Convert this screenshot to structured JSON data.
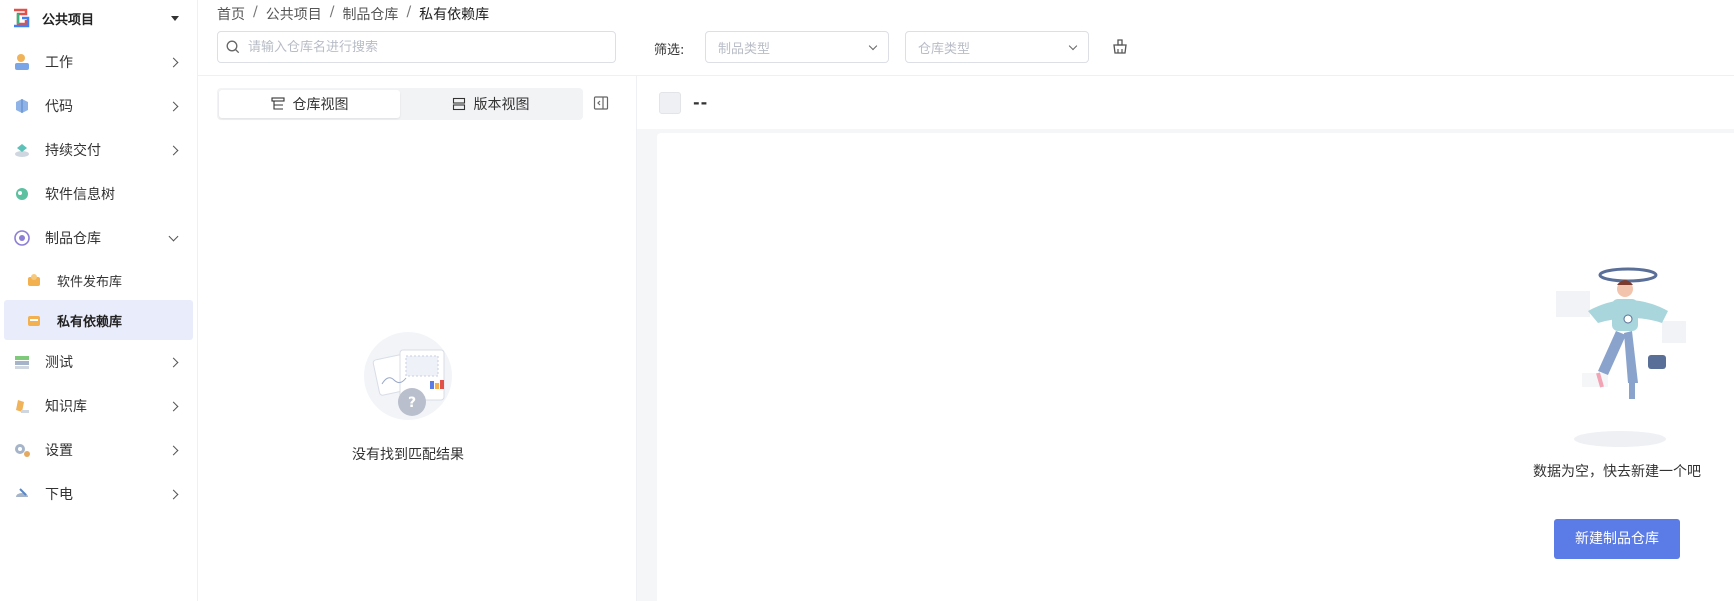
{
  "project": {
    "name": "公共项目"
  },
  "sidebar": {
    "items": [
      {
        "label": "工作"
      },
      {
        "label": "代码"
      },
      {
        "label": "持续交付"
      },
      {
        "label": "软件信息树"
      },
      {
        "label": "制品仓库"
      },
      {
        "label": "测试"
      },
      {
        "label": "知识库"
      },
      {
        "label": "设置"
      },
      {
        "label": "下电"
      }
    ],
    "sub_items": [
      {
        "label": "软件发布库"
      },
      {
        "label": "私有依赖库"
      }
    ]
  },
  "breadcrumb": {
    "items": [
      "首页",
      "公共项目",
      "制品仓库",
      "私有依赖库"
    ],
    "sep": "/"
  },
  "search": {
    "placeholder": "请输入仓库名进行搜索",
    "value": ""
  },
  "filter": {
    "label": "筛选:",
    "type_placeholder": "制品类型",
    "repo_placeholder": "仓库类型"
  },
  "view_switch": {
    "repo_view": "仓库视图",
    "version_view": "版本视图"
  },
  "left_empty": {
    "message": "没有找到匹配结果"
  },
  "right": {
    "title": "--",
    "empty_message": "数据为空，快去新建一个吧",
    "new_button": "新建制品仓库"
  },
  "colors": {
    "accent": "#5b7be6",
    "active_bg": "#e9edfb"
  }
}
